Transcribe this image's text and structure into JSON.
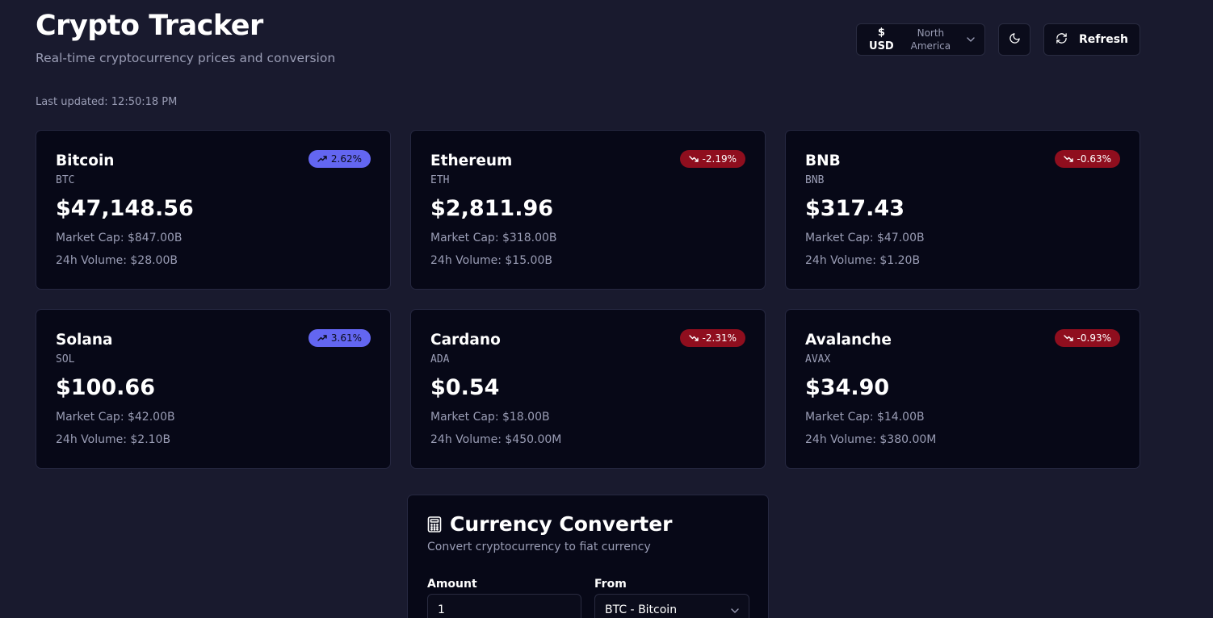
{
  "header": {
    "title": "Crypto Tracker",
    "subtitle": "Real-time cryptocurrency prices and conversion",
    "last_updated": "Last updated: 12:50:18 PM",
    "currency": {
      "symbol": "$",
      "code": "USD",
      "region_line1": "North",
      "region_line2": "America"
    },
    "refresh_label": "Refresh"
  },
  "coins": [
    {
      "name": "Bitcoin",
      "symbol": "BTC",
      "change": "2.62%",
      "trend": "up",
      "price": "$47,148.56",
      "market_cap": "Market Cap: $847.00B",
      "volume": "24h Volume: $28.00B"
    },
    {
      "name": "Ethereum",
      "symbol": "ETH",
      "change": "-2.19%",
      "trend": "down",
      "price": "$2,811.96",
      "market_cap": "Market Cap: $318.00B",
      "volume": "24h Volume: $15.00B"
    },
    {
      "name": "BNB",
      "symbol": "BNB",
      "change": "-0.63%",
      "trend": "down",
      "price": "$317.43",
      "market_cap": "Market Cap: $47.00B",
      "volume": "24h Volume: $1.20B"
    },
    {
      "name": "Solana",
      "symbol": "SOL",
      "change": "3.61%",
      "trend": "up",
      "price": "$100.66",
      "market_cap": "Market Cap: $42.00B",
      "volume": "24h Volume: $2.10B"
    },
    {
      "name": "Cardano",
      "symbol": "ADA",
      "change": "-2.31%",
      "trend": "down",
      "price": "$0.54",
      "market_cap": "Market Cap: $18.00B",
      "volume": "24h Volume: $450.00M"
    },
    {
      "name": "Avalanche",
      "symbol": "AVAX",
      "change": "-0.93%",
      "trend": "down",
      "price": "$34.90",
      "market_cap": "Market Cap: $14.00B",
      "volume": "24h Volume: $380.00M"
    }
  ],
  "converter": {
    "icon": "calculator-icon",
    "title": "Currency Converter",
    "subtitle": "Convert cryptocurrency to fiat currency",
    "amount_label": "Amount",
    "amount_value": "1",
    "from_label": "From",
    "from_value": "BTC - Bitcoin"
  },
  "colors": {
    "background": "#191a2e",
    "card": "#070817",
    "up_badge": "#6366f1",
    "down_badge": "#8f0e1e",
    "muted_text": "#9a9db5"
  }
}
